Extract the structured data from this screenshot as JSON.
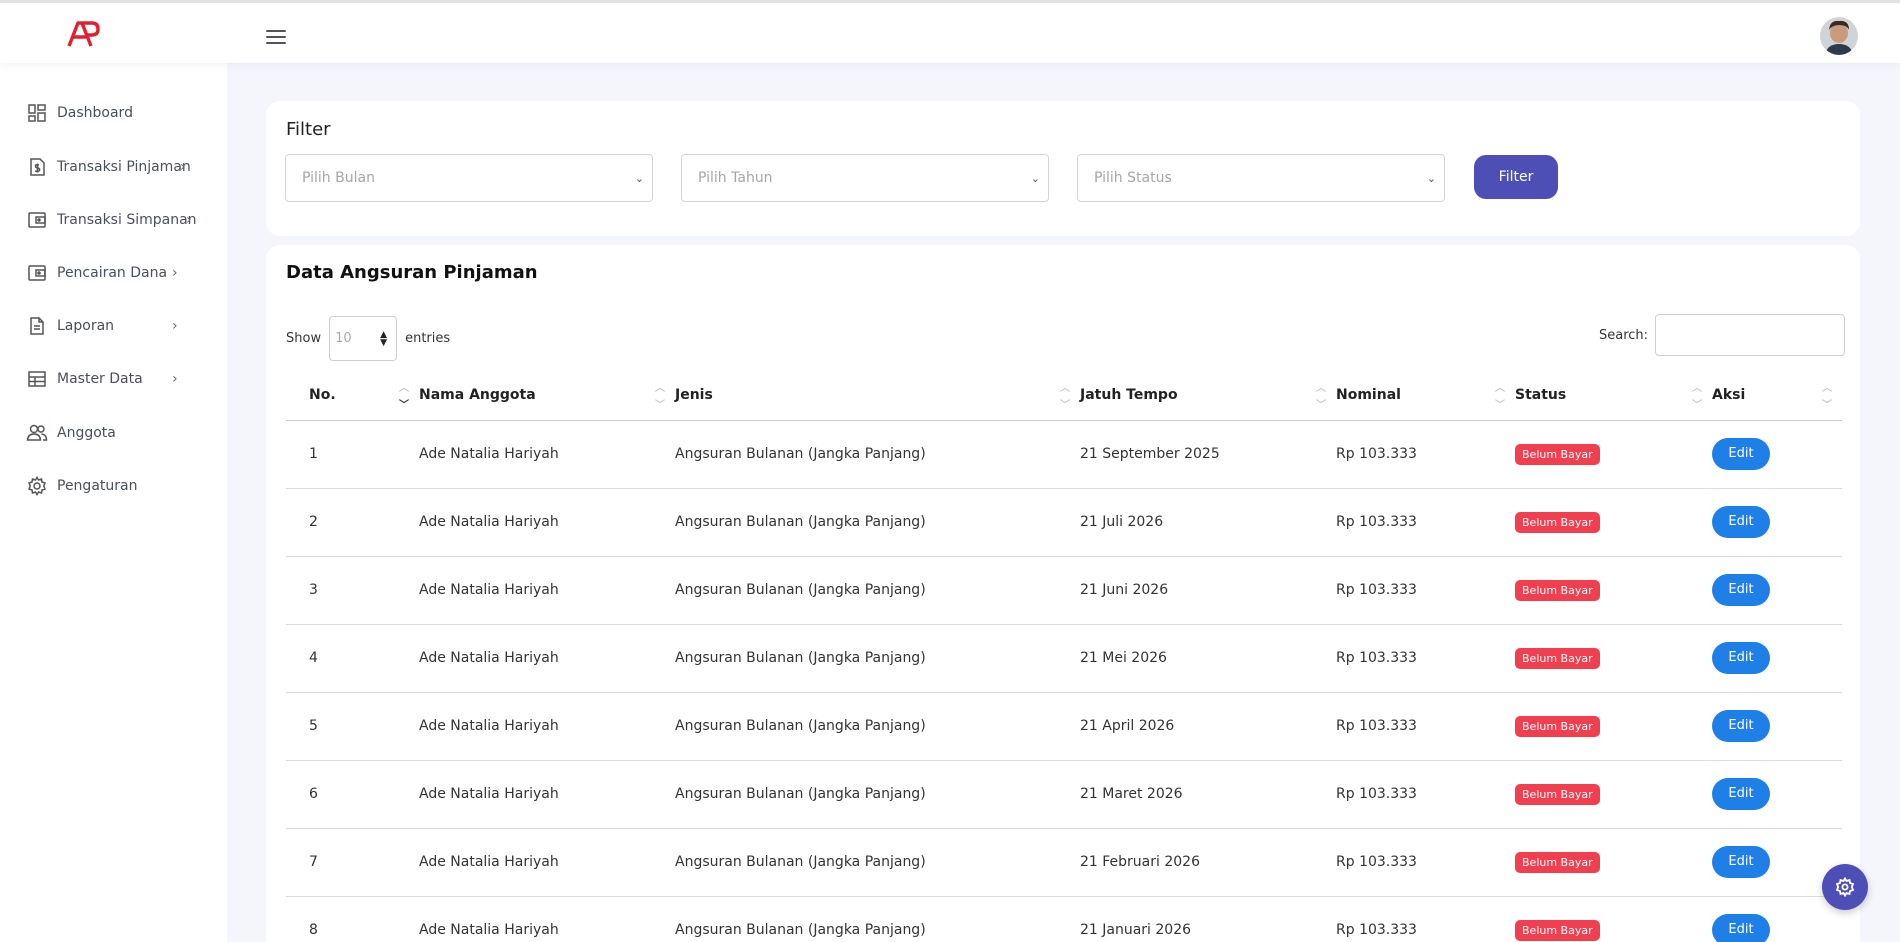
{
  "sidebar": {
    "items": [
      {
        "label": "Dashboard",
        "icon": "dashboard-icon",
        "has_chevron": false
      },
      {
        "label": "Transaksi Pinjaman",
        "icon": "dollar-doc-icon",
        "has_chevron": true
      },
      {
        "label": "Transaksi Simpanan",
        "icon": "wallet-icon",
        "has_chevron": true
      },
      {
        "label": "Pencairan Dana",
        "icon": "wallet-icon",
        "has_chevron": true
      },
      {
        "label": "Laporan",
        "icon": "document-icon",
        "has_chevron": true
      },
      {
        "label": "Master Data",
        "icon": "table-icon",
        "has_chevron": true
      },
      {
        "label": "Anggota",
        "icon": "users-icon",
        "has_chevron": false
      },
      {
        "label": "Pengaturan",
        "icon": "gear-icon",
        "has_chevron": false
      }
    ]
  },
  "filter": {
    "title": "Filter",
    "month_placeholder": "Pilih Bulan",
    "year_placeholder": "Pilih Tahun",
    "status_placeholder": "Pilih Status",
    "button_label": "Filter"
  },
  "table_card": {
    "title": "Data Angsuran Pinjaman",
    "show_label": "Show",
    "length_value": "10",
    "entries_label": "entries",
    "search_label": "Search:",
    "columns": [
      "No.",
      "Nama Anggota",
      "Jenis",
      "Jatuh Tempo",
      "Nominal",
      "Status",
      "Aksi"
    ],
    "rows": [
      {
        "no": "1",
        "nama": "Ade Natalia Hariyah",
        "jenis": "Angsuran Bulanan (Jangka Panjang)",
        "jatuh_tempo": "21 September 2025",
        "nominal": "Rp 103.333",
        "status": "Belum Bayar",
        "aksi": "Edit"
      },
      {
        "no": "2",
        "nama": "Ade Natalia Hariyah",
        "jenis": "Angsuran Bulanan (Jangka Panjang)",
        "jatuh_tempo": "21 Juli 2026",
        "nominal": "Rp 103.333",
        "status": "Belum Bayar",
        "aksi": "Edit"
      },
      {
        "no": "3",
        "nama": "Ade Natalia Hariyah",
        "jenis": "Angsuran Bulanan (Jangka Panjang)",
        "jatuh_tempo": "21 Juni 2026",
        "nominal": "Rp 103.333",
        "status": "Belum Bayar",
        "aksi": "Edit"
      },
      {
        "no": "4",
        "nama": "Ade Natalia Hariyah",
        "jenis": "Angsuran Bulanan (Jangka Panjang)",
        "jatuh_tempo": "21 Mei 2026",
        "nominal": "Rp 103.333",
        "status": "Belum Bayar",
        "aksi": "Edit"
      },
      {
        "no": "5",
        "nama": "Ade Natalia Hariyah",
        "jenis": "Angsuran Bulanan (Jangka Panjang)",
        "jatuh_tempo": "21 April 2026",
        "nominal": "Rp 103.333",
        "status": "Belum Bayar",
        "aksi": "Edit"
      },
      {
        "no": "6",
        "nama": "Ade Natalia Hariyah",
        "jenis": "Angsuran Bulanan (Jangka Panjang)",
        "jatuh_tempo": "21 Maret 2026",
        "nominal": "Rp 103.333",
        "status": "Belum Bayar",
        "aksi": "Edit"
      },
      {
        "no": "7",
        "nama": "Ade Natalia Hariyah",
        "jenis": "Angsuran Bulanan (Jangka Panjang)",
        "jatuh_tempo": "21 Februari 2026",
        "nominal": "Rp 103.333",
        "status": "Belum Bayar",
        "aksi": "Edit"
      },
      {
        "no": "8",
        "nama": "Ade Natalia Hariyah",
        "jenis": "Angsuran Bulanan (Jangka Panjang)",
        "jatuh_tempo": "21 Januari 2026",
        "nominal": "Rp 103.333",
        "status": "Belum Bayar",
        "aksi": "Edit"
      }
    ]
  },
  "colors": {
    "brand_red": "#e02030",
    "accent_purple": "#4e4fb6",
    "badge_red": "#f04050",
    "edit_blue": "#1e7fe6"
  }
}
